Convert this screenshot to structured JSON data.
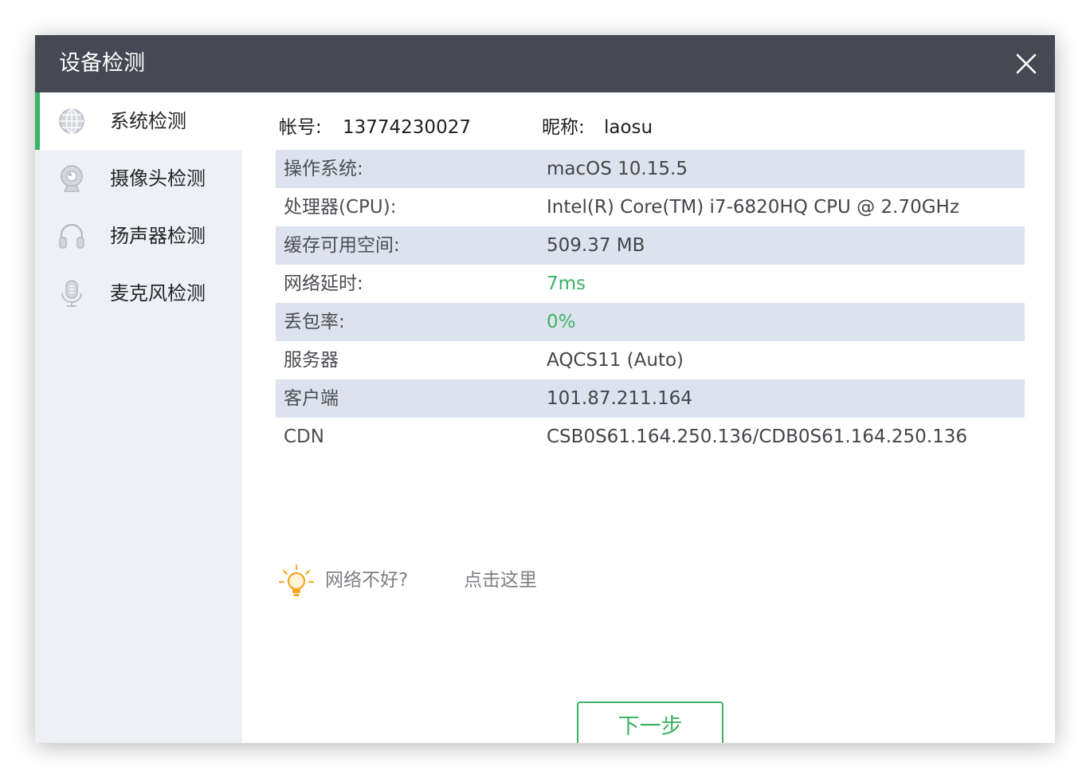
{
  "window": {
    "title": "设备检测",
    "close_icon": "close-icon"
  },
  "sidebar": {
    "items": [
      {
        "label": "系统检测",
        "icon": "globe-icon",
        "active": true
      },
      {
        "label": "摄像头检测",
        "icon": "camera-icon",
        "active": false
      },
      {
        "label": "扬声器检测",
        "icon": "headphones-icon",
        "active": false
      },
      {
        "label": "麦克风检测",
        "icon": "microphone-icon",
        "active": false
      }
    ]
  },
  "account": {
    "id_label": "帐号:",
    "id_value": "13774230027",
    "nick_label": "昵称:",
    "nick_value": "laosu"
  },
  "info": {
    "rows": [
      {
        "key": "操作系统:",
        "value": "macOS 10.15.5"
      },
      {
        "key": "处理器(CPU):",
        "value": "Intel(R) Core(TM) i7-6820HQ CPU @ 2.70GHz"
      },
      {
        "key": "缓存可用空间:",
        "value": "509.37 MB"
      },
      {
        "key": "网络延时:",
        "value": "7ms"
      },
      {
        "key": "丢包率:",
        "value": "0%"
      },
      {
        "key": "服务器",
        "value": "AQCS11 (Auto)"
      },
      {
        "key": "客户端",
        "value": "101.87.211.164"
      },
      {
        "key": "CDN",
        "value": "CSB0S61.164.250.136/CDB0S61.164.250.136"
      }
    ]
  },
  "tip": {
    "text": "网络不好?",
    "link": "点击这里",
    "icon": "lightbulb-icon"
  },
  "footer": {
    "next_label": "下一步"
  },
  "colors": {
    "titlebar": "#464853",
    "accent": "#3cb264",
    "row_shade": "#dde3ee",
    "sidebar_bg": "#eff0f5",
    "bulb": "#f5a623"
  }
}
